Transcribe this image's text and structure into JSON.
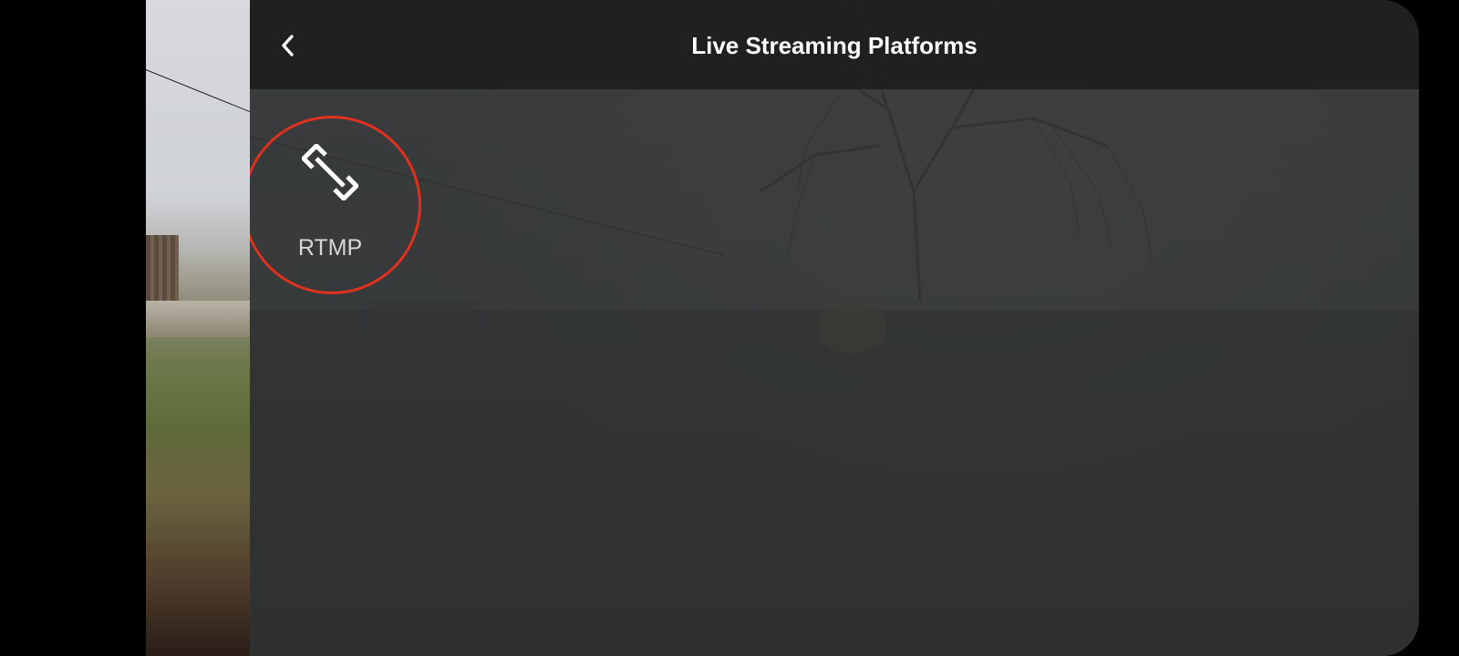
{
  "header": {
    "title": "Live Streaming Platforms",
    "back_icon": "chevron-left-icon"
  },
  "platforms": [
    {
      "label": "RTMP",
      "icon": "link-icon"
    }
  ],
  "colors": {
    "header_bg": "#1c1d1e",
    "panel_bg": "#383a3b",
    "title_text": "#ffffff",
    "label_text": "#d7d7d7",
    "highlight_ring": "#e0301e"
  }
}
